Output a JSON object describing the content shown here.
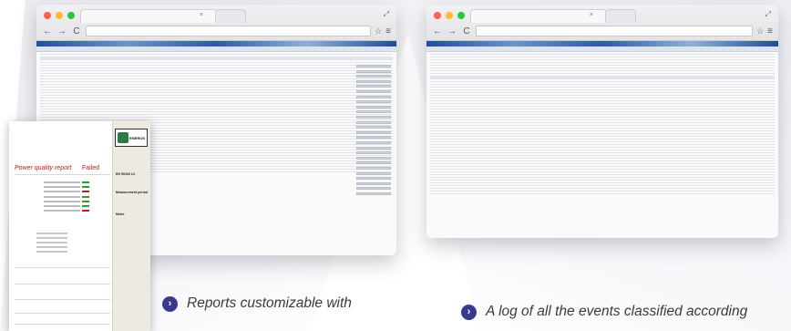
{
  "left_window": {
    "tab_close": "×",
    "nav": {
      "back": "←",
      "forward": "→",
      "reload": "C"
    },
    "star": "☆",
    "menu": "≡",
    "expand": "⤢"
  },
  "right_window": {
    "tab_close": "×",
    "nav": {
      "back": "←",
      "forward": "→",
      "reload": "C"
    },
    "star": "☆",
    "menu": "≡",
    "expand": "⤢"
  },
  "report": {
    "title": "Power quality report",
    "status": "Failed",
    "logo_text": "ENEROS",
    "side_heading_1": "EN 50160 LV",
    "side_heading_2": "Measurement period",
    "side_heading_3": "Meter"
  },
  "features": [
    {
      "icon": "chevron-right-icon",
      "text": "Reports customizable with"
    },
    {
      "icon": "chevron-right-icon",
      "text": "A log of all the events classified according"
    }
  ],
  "colors": {
    "accent": "#3a3a8c",
    "failed": "#c11b1b",
    "passed": "#2a9d2a",
    "header_band": "#1f4f9e"
  }
}
